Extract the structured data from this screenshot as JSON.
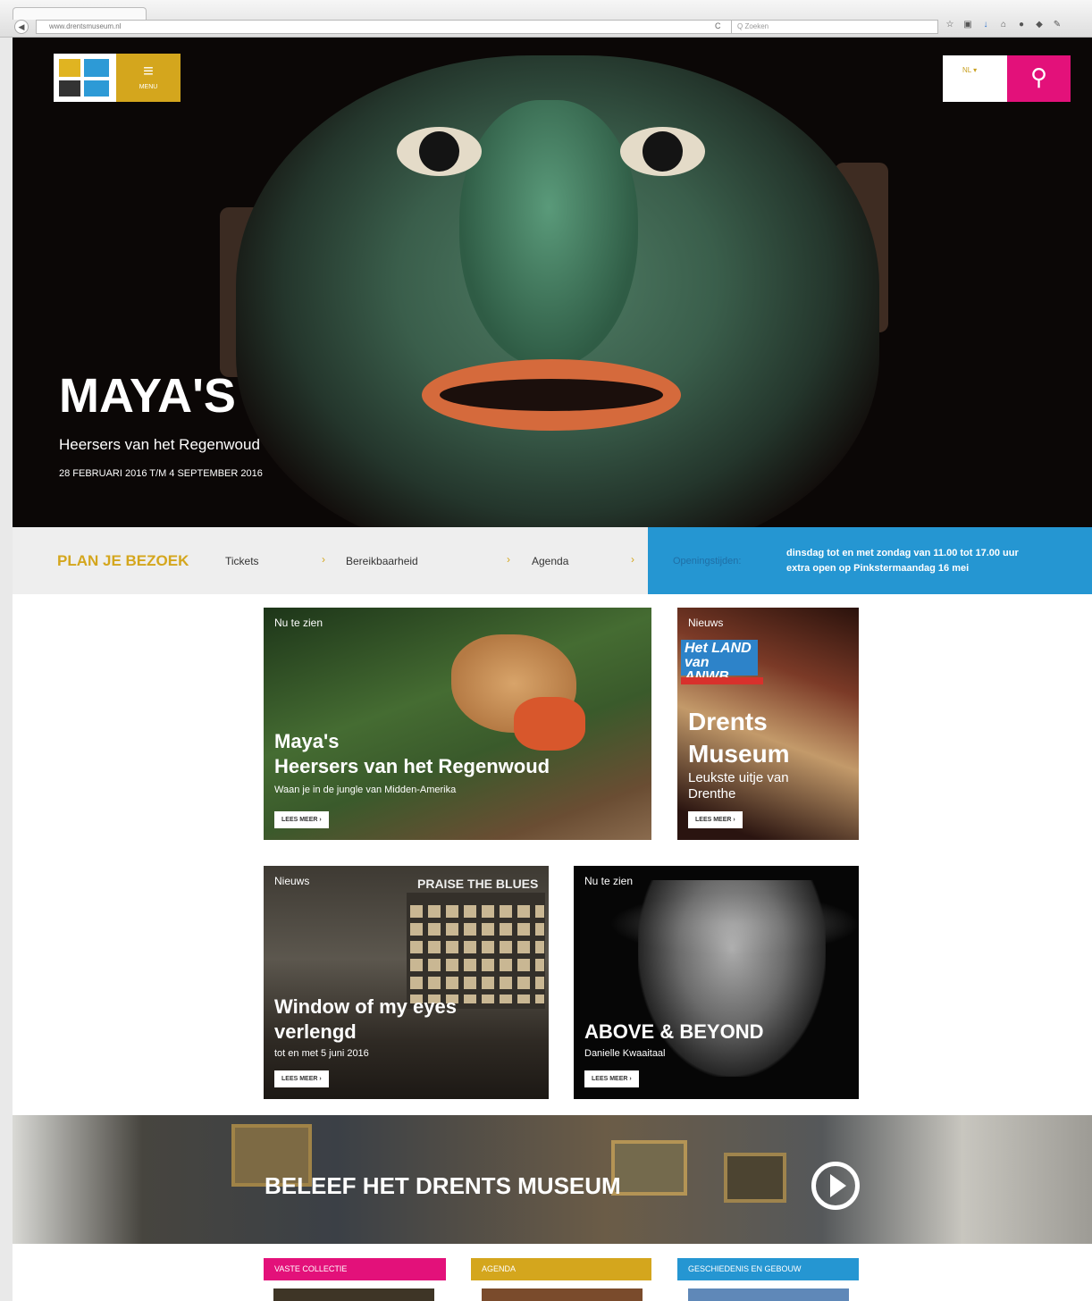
{
  "browser": {
    "url": "www.drentsmuseum.nl",
    "search_placeholder": "Q Zoeken",
    "reload": "C",
    "back": "◀"
  },
  "header": {
    "menu_label": "MENU",
    "language": "NL ▾"
  },
  "hero": {
    "title": "MAYA'S",
    "subtitle": "Heersers van het Regenwoud",
    "date": "28 FEBRUARI 2016 T/M 4 SEPTEMBER 2016"
  },
  "plan": {
    "title": "PLAN JE BEZOEK",
    "links": [
      "Tickets",
      "Bereikbaarheid",
      "Agenda"
    ],
    "arrow": "›",
    "hours_label": "Openingstijden:",
    "hours_line1": "dinsdag tot en met zondag van 11.00 tot 17.00 uur",
    "hours_line2": "extra open op Pinkstermaandag 16 mei"
  },
  "cards": [
    {
      "tag": "Nu te zien",
      "title1": "Maya's",
      "title2": "Heersers van het Regenwoud",
      "desc": "Waan je in de jungle van Midden-Amerika",
      "button": "LEES MEER  ›"
    },
    {
      "tag": "Nieuws",
      "badge": "Het LAND van ANWB",
      "title1": "Drents",
      "title2": "Museum",
      "desc1": "Leukste uitje van",
      "desc2": "Drenthe",
      "button": "LEES MEER  ›"
    },
    {
      "tag": "Nieuws",
      "overlay": "PRAISE THE BLUES",
      "title1": "Window of my eyes",
      "title2": "verlengd",
      "desc": "tot en met 5 juni 2016",
      "button": "LEES MEER  ›"
    },
    {
      "tag": "Nu te zien",
      "title1": "ABOVE & BEYOND",
      "desc": "Danielle Kwaaitaal",
      "button": "LEES MEER  ›"
    }
  ],
  "beleef": {
    "title": "BELEEF HET DRENTS MUSEUM"
  },
  "categories": [
    {
      "label": "VASTE COLLECTIE",
      "color": "#e3117a"
    },
    {
      "label": "AGENDA",
      "color": "#d4a61d"
    },
    {
      "label": "GESCHIEDENIS EN GEBOUW",
      "color": "#2596d2"
    }
  ]
}
